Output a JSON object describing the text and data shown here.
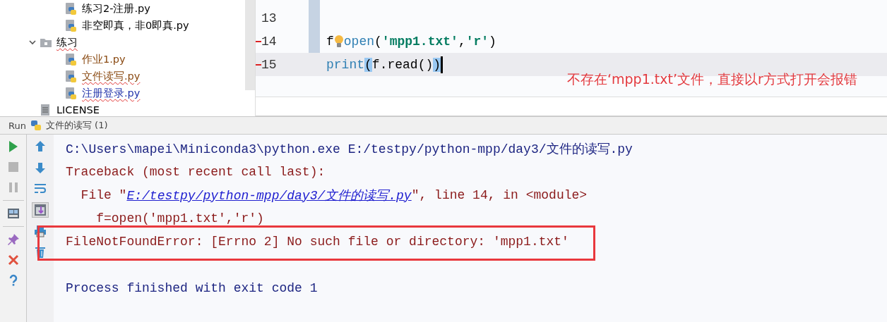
{
  "project_tree": {
    "items": [
      {
        "kind": "hidden_parent",
        "children": [
          {
            "kind": "python_file",
            "label": "练习2-注册.py",
            "color": "#000000",
            "misspelled": false
          },
          {
            "kind": "python_file",
            "label": "非空即真，非0即真.py",
            "color": "#000000",
            "misspelled": false
          }
        ]
      },
      {
        "kind": "folder",
        "label": "练习",
        "expanded": true,
        "color": "#000000",
        "misspelled": true,
        "children": [
          {
            "kind": "python_file",
            "label": "作业1.py",
            "color": "#8a4a12",
            "misspelled": false
          },
          {
            "kind": "python_file",
            "label": "文件读写.py",
            "color": "#8a4a12",
            "misspelled": true
          },
          {
            "kind": "python_file",
            "label": "注册登录.py",
            "color": "#2233aa",
            "misspelled": true
          }
        ]
      },
      {
        "kind": "text_file",
        "label": "LICENSE",
        "color": "#000000",
        "misspelled": false
      }
    ]
  },
  "editor": {
    "lines": [
      {
        "number": "13",
        "current": false,
        "changed": false,
        "caret": false
      },
      {
        "number": "14",
        "current": false,
        "changed": true,
        "caret": false,
        "tokens": [
          {
            "kind": "plain",
            "text": "f"
          },
          {
            "kind": "bulb"
          },
          {
            "kind": "builtin",
            "text": "open"
          },
          {
            "kind": "plain",
            "text": "("
          },
          {
            "kind": "string",
            "text": "'mpp1.txt'"
          },
          {
            "kind": "plain",
            "text": ","
          },
          {
            "kind": "string",
            "text": "'r'"
          },
          {
            "kind": "plain",
            "text": ")"
          }
        ]
      },
      {
        "number": "15",
        "current": true,
        "changed": true,
        "caret": true,
        "tokens": [
          {
            "kind": "builtin",
            "text": "print"
          },
          {
            "kind": "brace",
            "text": "("
          },
          {
            "kind": "plain",
            "text": "f.read()"
          },
          {
            "kind": "brace",
            "text": ")"
          }
        ]
      }
    ],
    "annotation": "不存在‘mpp1.txt’文件，直接以r方式打开会报错"
  },
  "run_panel": {
    "label": "Run",
    "config": "文件的读写 (1)",
    "left_toolbar": [
      {
        "kind": "run",
        "disabled": false
      },
      {
        "kind": "stop",
        "disabled": true
      },
      {
        "kind": "pause",
        "disabled": true
      },
      {
        "kind": "separator"
      },
      {
        "kind": "layout",
        "disabled": false
      },
      {
        "kind": "separator"
      },
      {
        "kind": "pin",
        "disabled": false
      },
      {
        "kind": "close",
        "disabled": false
      },
      {
        "kind": "help",
        "disabled": false
      }
    ],
    "right_toolbar": [
      {
        "kind": "up",
        "selected": false
      },
      {
        "kind": "down",
        "selected": false
      },
      {
        "kind": "wrap",
        "selected": false
      },
      {
        "kind": "scroll_end",
        "selected": true
      },
      {
        "kind": "print",
        "selected": false
      },
      {
        "kind": "trash",
        "selected": false
      }
    ],
    "console": [
      {
        "kind": "text",
        "highlighted": false,
        "segments": [
          {
            "kind": "command",
            "text": "C:\\Users\\mapei\\Miniconda3\\python.exe E:/testpy/python-mpp/day3/文件的读写.py"
          }
        ]
      },
      {
        "kind": "text",
        "highlighted": false,
        "segments": [
          {
            "kind": "error",
            "text": "Traceback (most recent call last):"
          }
        ]
      },
      {
        "kind": "text",
        "highlighted": false,
        "segments": [
          {
            "kind": "error",
            "text": "  File \""
          },
          {
            "kind": "link",
            "text": "E:/testpy/python-mpp/day3/文件的读写.py"
          },
          {
            "kind": "error",
            "text": "\", line 14, in <module>"
          }
        ]
      },
      {
        "kind": "text",
        "highlighted": false,
        "segments": [
          {
            "kind": "error",
            "text": "    f=open('mpp1.txt','r')"
          }
        ]
      },
      {
        "kind": "text",
        "highlighted": true,
        "segments": [
          {
            "kind": "error",
            "text": "FileNotFoundError: [Errno 2] No such file or directory: 'mpp1.txt'"
          }
        ]
      },
      {
        "kind": "blank"
      },
      {
        "kind": "text",
        "highlighted": false,
        "segments": [
          {
            "kind": "command",
            "text": "Process finished with exit code 1"
          }
        ]
      }
    ]
  }
}
